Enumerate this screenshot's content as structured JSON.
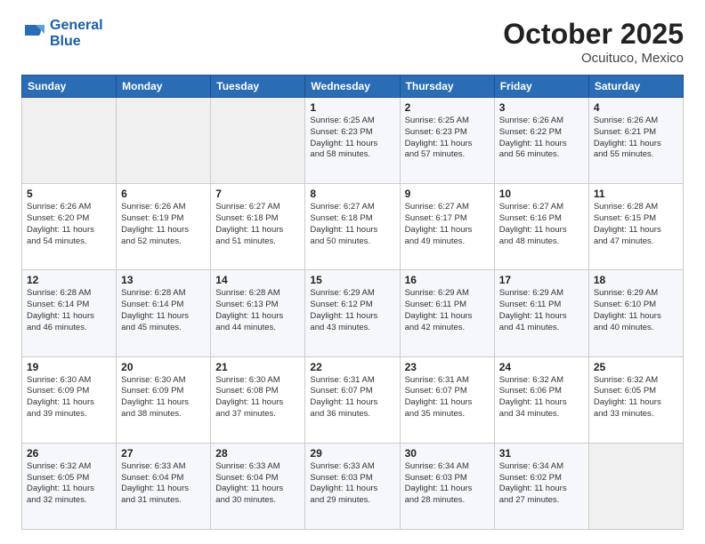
{
  "logo": {
    "line1": "General",
    "line2": "Blue"
  },
  "title": "October 2025",
  "location": "Ocuituco, Mexico",
  "days_header": [
    "Sunday",
    "Monday",
    "Tuesday",
    "Wednesday",
    "Thursday",
    "Friday",
    "Saturday"
  ],
  "weeks": [
    [
      {
        "day": "",
        "info": ""
      },
      {
        "day": "",
        "info": ""
      },
      {
        "day": "",
        "info": ""
      },
      {
        "day": "1",
        "info": "Sunrise: 6:25 AM\nSunset: 6:23 PM\nDaylight: 11 hours\nand 58 minutes."
      },
      {
        "day": "2",
        "info": "Sunrise: 6:25 AM\nSunset: 6:23 PM\nDaylight: 11 hours\nand 57 minutes."
      },
      {
        "day": "3",
        "info": "Sunrise: 6:26 AM\nSunset: 6:22 PM\nDaylight: 11 hours\nand 56 minutes."
      },
      {
        "day": "4",
        "info": "Sunrise: 6:26 AM\nSunset: 6:21 PM\nDaylight: 11 hours\nand 55 minutes."
      }
    ],
    [
      {
        "day": "5",
        "info": "Sunrise: 6:26 AM\nSunset: 6:20 PM\nDaylight: 11 hours\nand 54 minutes."
      },
      {
        "day": "6",
        "info": "Sunrise: 6:26 AM\nSunset: 6:19 PM\nDaylight: 11 hours\nand 52 minutes."
      },
      {
        "day": "7",
        "info": "Sunrise: 6:27 AM\nSunset: 6:18 PM\nDaylight: 11 hours\nand 51 minutes."
      },
      {
        "day": "8",
        "info": "Sunrise: 6:27 AM\nSunset: 6:18 PM\nDaylight: 11 hours\nand 50 minutes."
      },
      {
        "day": "9",
        "info": "Sunrise: 6:27 AM\nSunset: 6:17 PM\nDaylight: 11 hours\nand 49 minutes."
      },
      {
        "day": "10",
        "info": "Sunrise: 6:27 AM\nSunset: 6:16 PM\nDaylight: 11 hours\nand 48 minutes."
      },
      {
        "day": "11",
        "info": "Sunrise: 6:28 AM\nSunset: 6:15 PM\nDaylight: 11 hours\nand 47 minutes."
      }
    ],
    [
      {
        "day": "12",
        "info": "Sunrise: 6:28 AM\nSunset: 6:14 PM\nDaylight: 11 hours\nand 46 minutes."
      },
      {
        "day": "13",
        "info": "Sunrise: 6:28 AM\nSunset: 6:14 PM\nDaylight: 11 hours\nand 45 minutes."
      },
      {
        "day": "14",
        "info": "Sunrise: 6:28 AM\nSunset: 6:13 PM\nDaylight: 11 hours\nand 44 minutes."
      },
      {
        "day": "15",
        "info": "Sunrise: 6:29 AM\nSunset: 6:12 PM\nDaylight: 11 hours\nand 43 minutes."
      },
      {
        "day": "16",
        "info": "Sunrise: 6:29 AM\nSunset: 6:11 PM\nDaylight: 11 hours\nand 42 minutes."
      },
      {
        "day": "17",
        "info": "Sunrise: 6:29 AM\nSunset: 6:11 PM\nDaylight: 11 hours\nand 41 minutes."
      },
      {
        "day": "18",
        "info": "Sunrise: 6:29 AM\nSunset: 6:10 PM\nDaylight: 11 hours\nand 40 minutes."
      }
    ],
    [
      {
        "day": "19",
        "info": "Sunrise: 6:30 AM\nSunset: 6:09 PM\nDaylight: 11 hours\nand 39 minutes."
      },
      {
        "day": "20",
        "info": "Sunrise: 6:30 AM\nSunset: 6:09 PM\nDaylight: 11 hours\nand 38 minutes."
      },
      {
        "day": "21",
        "info": "Sunrise: 6:30 AM\nSunset: 6:08 PM\nDaylight: 11 hours\nand 37 minutes."
      },
      {
        "day": "22",
        "info": "Sunrise: 6:31 AM\nSunset: 6:07 PM\nDaylight: 11 hours\nand 36 minutes."
      },
      {
        "day": "23",
        "info": "Sunrise: 6:31 AM\nSunset: 6:07 PM\nDaylight: 11 hours\nand 35 minutes."
      },
      {
        "day": "24",
        "info": "Sunrise: 6:32 AM\nSunset: 6:06 PM\nDaylight: 11 hours\nand 34 minutes."
      },
      {
        "day": "25",
        "info": "Sunrise: 6:32 AM\nSunset: 6:05 PM\nDaylight: 11 hours\nand 33 minutes."
      }
    ],
    [
      {
        "day": "26",
        "info": "Sunrise: 6:32 AM\nSunset: 6:05 PM\nDaylight: 11 hours\nand 32 minutes."
      },
      {
        "day": "27",
        "info": "Sunrise: 6:33 AM\nSunset: 6:04 PM\nDaylight: 11 hours\nand 31 minutes."
      },
      {
        "day": "28",
        "info": "Sunrise: 6:33 AM\nSunset: 6:04 PM\nDaylight: 11 hours\nand 30 minutes."
      },
      {
        "day": "29",
        "info": "Sunrise: 6:33 AM\nSunset: 6:03 PM\nDaylight: 11 hours\nand 29 minutes."
      },
      {
        "day": "30",
        "info": "Sunrise: 6:34 AM\nSunset: 6:03 PM\nDaylight: 11 hours\nand 28 minutes."
      },
      {
        "day": "31",
        "info": "Sunrise: 6:34 AM\nSunset: 6:02 PM\nDaylight: 11 hours\nand 27 minutes."
      },
      {
        "day": "",
        "info": ""
      }
    ]
  ]
}
